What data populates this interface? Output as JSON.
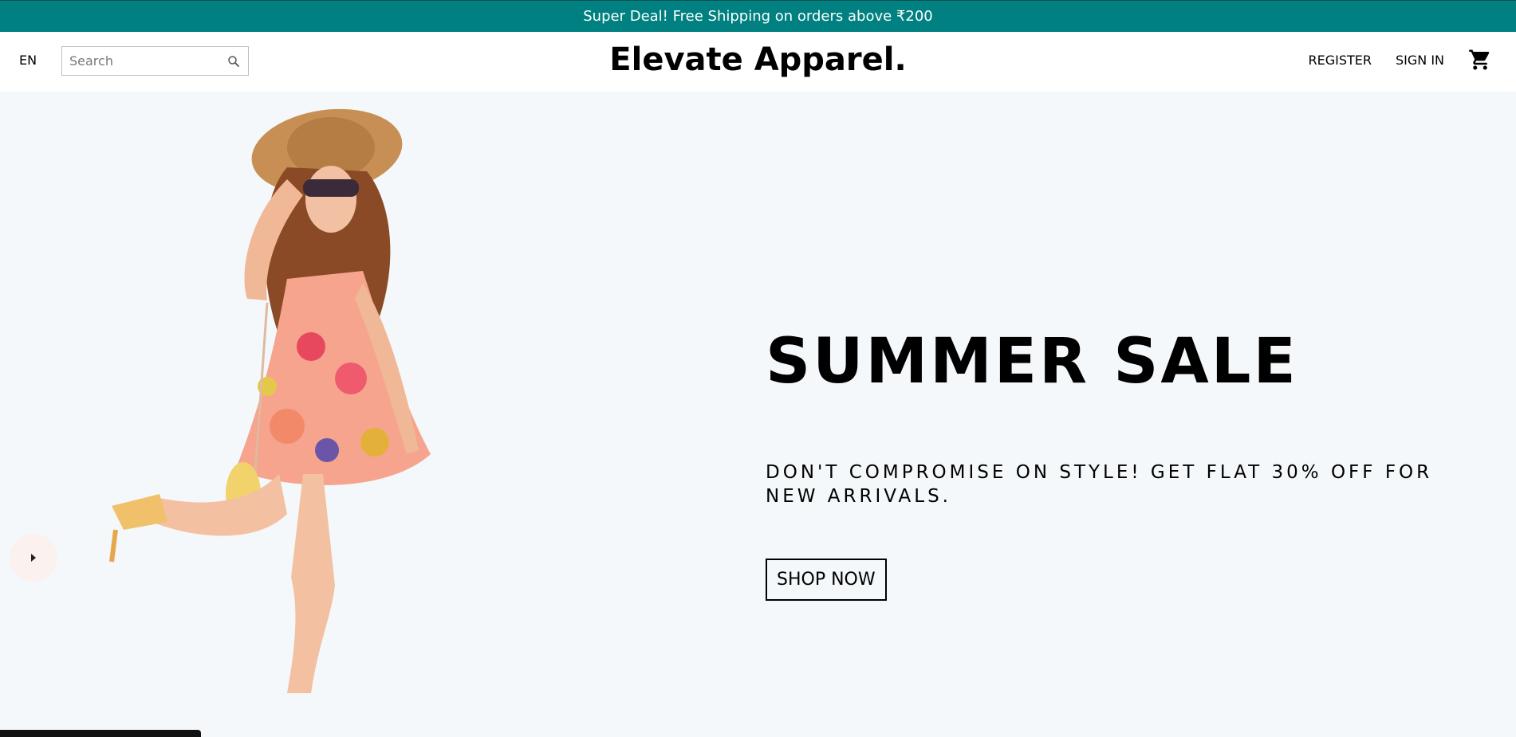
{
  "announcement": {
    "text": "Super Deal! Free Shipping on orders above ₹200"
  },
  "navbar": {
    "language": "EN",
    "search": {
      "placeholder": "Search",
      "value": ""
    },
    "logo": "Elevate Apparel.",
    "register_label": "REGISTER",
    "signin_label": "SIGN IN",
    "cart_icon": "shopping-cart-icon"
  },
  "hero": {
    "title": "SUMMER SALE",
    "description": "DON'T COMPROMISE ON STYLE! GET FLAT 30% OFF FOR NEW ARRIVALS.",
    "cta_label": "SHOP NOW",
    "prev_icon": "arrow-left-icon"
  },
  "colors": {
    "announcement_bg": "#008080",
    "hero_bg": "#f4f8fa",
    "arrow_bg": "#fbf1ef"
  }
}
